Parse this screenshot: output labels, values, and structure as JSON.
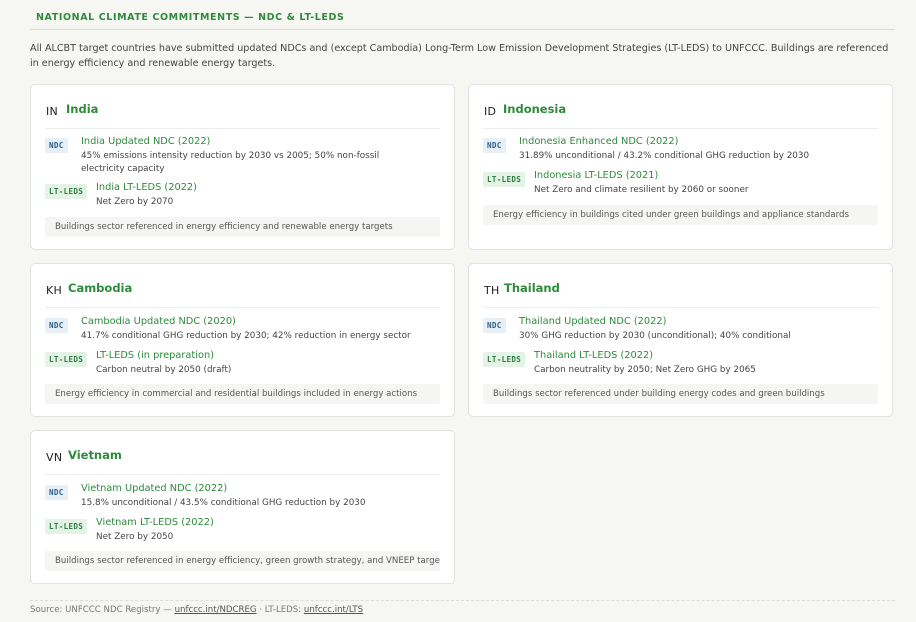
{
  "header": {
    "title": "NATIONAL CLIMATE COMMITMENTS — NDC & LT-LEDS"
  },
  "intro": "All ALCBT target countries have submitted updated NDCs and (except Cambodia) Long-Term Low Emission Development Strategies (LT-LEDS) to UNFCCC. Buildings are referenced in energy efficiency and renewable energy targets.",
  "badges": {
    "ndc": "NDC",
    "lt": "LT-LEDS"
  },
  "countries": {
    "india": {
      "iso": "IN",
      "name": "India",
      "ndc_title": "India Updated NDC (2022)",
      "ndc_desc": "45% emissions intensity reduction by 2030 vs 2005; 50% non-fossil electricity capacity",
      "lt_title": "India LT-LEDS (2022)",
      "lt_desc": "Net Zero by 2070",
      "note": "Buildings sector referenced in energy efficiency and renewable energy targets"
    },
    "indonesia": {
      "iso": "ID",
      "name": "Indonesia",
      "ndc_title": "Indonesia Enhanced NDC (2022)",
      "ndc_desc": "31.89% unconditional / 43.2% conditional GHG reduction by 2030",
      "lt_title": "Indonesia LT-LEDS (2021)",
      "lt_desc": "Net Zero and climate resilient by 2060 or sooner",
      "note": "Energy efficiency in buildings cited under green buildings and appliance standards"
    },
    "cambodia": {
      "iso": "KH",
      "name": "Cambodia",
      "ndc_title": "Cambodia Updated NDC (2020)",
      "ndc_desc": "41.7% conditional GHG reduction by 2030; 42% reduction in energy sector",
      "lt_title": "LT-LEDS (in preparation)",
      "lt_desc": "Carbon neutral by 2050 (draft)",
      "note": "Energy efficiency in commercial and residential buildings included in energy actions"
    },
    "thailand": {
      "iso": "TH",
      "name": "Thailand",
      "ndc_title": "Thailand Updated NDC (2022)",
      "ndc_desc": "30% GHG reduction by 2030 (unconditional); 40% conditional",
      "lt_title": "Thailand LT-LEDS (2022)",
      "lt_desc": "Carbon neutrality by 2050; Net Zero GHG by 2065",
      "note": "Buildings sector referenced under building energy codes and green buildings"
    },
    "vietnam": {
      "iso": "VN",
      "name": "Vietnam",
      "ndc_title": "Vietnam Updated NDC (2022)",
      "ndc_desc": "15.8% unconditional / 43.5% conditional GHG reduction by 2030",
      "lt_title": "Vietnam LT-LEDS (2022)",
      "lt_desc": "Net Zero by 2050",
      "note": "Buildings sector referenced in energy efficiency, green growth strategy, and VNEEP targets"
    }
  },
  "footer": {
    "prefix": "Source: UNFCCC NDC Registry —",
    "link1": "unfccc.int/NDCREG",
    "middle": "· LT-LEDS:",
    "link2": "unfccc.int/LTS"
  },
  "colors": {
    "accent": "#2e8b3c",
    "ndc_badge": "#2b5f8c",
    "lt_badge": "#2e7d40"
  }
}
